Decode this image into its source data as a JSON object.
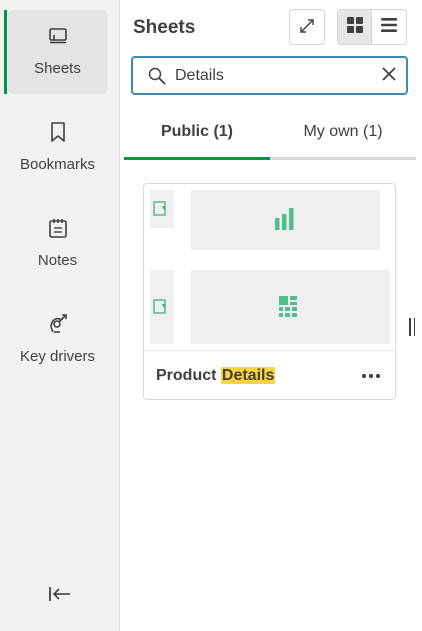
{
  "rail": {
    "items": [
      {
        "label": "Sheets",
        "icon": "sheet-icon"
      },
      {
        "label": "Bookmarks",
        "icon": "bookmark-icon"
      },
      {
        "label": "Notes",
        "icon": "notes-icon"
      },
      {
        "label": "Key drivers",
        "icon": "key-drivers-icon"
      }
    ],
    "active_index": 0,
    "collapse_icon": "collapse-panel-icon"
  },
  "panel": {
    "title": "Sheets",
    "expand_icon": "expand-icon",
    "view_modes": [
      "grid-view-icon",
      "list-view-icon"
    ],
    "active_view": "grid"
  },
  "search": {
    "value": "Details",
    "icon": "search-icon",
    "clear_icon": "close-icon"
  },
  "tabs": [
    {
      "label": "Public (1)",
      "active": true
    },
    {
      "label": "My own (1)",
      "active": false
    }
  ],
  "sheets": [
    {
      "title_prefix": "Product ",
      "title_highlight": "Details",
      "menu_icon": "more-options-icon"
    }
  ],
  "colors": {
    "accent_green": "#009845",
    "highlight": "#fdd33c",
    "focus_border": "#3f8ab3"
  }
}
